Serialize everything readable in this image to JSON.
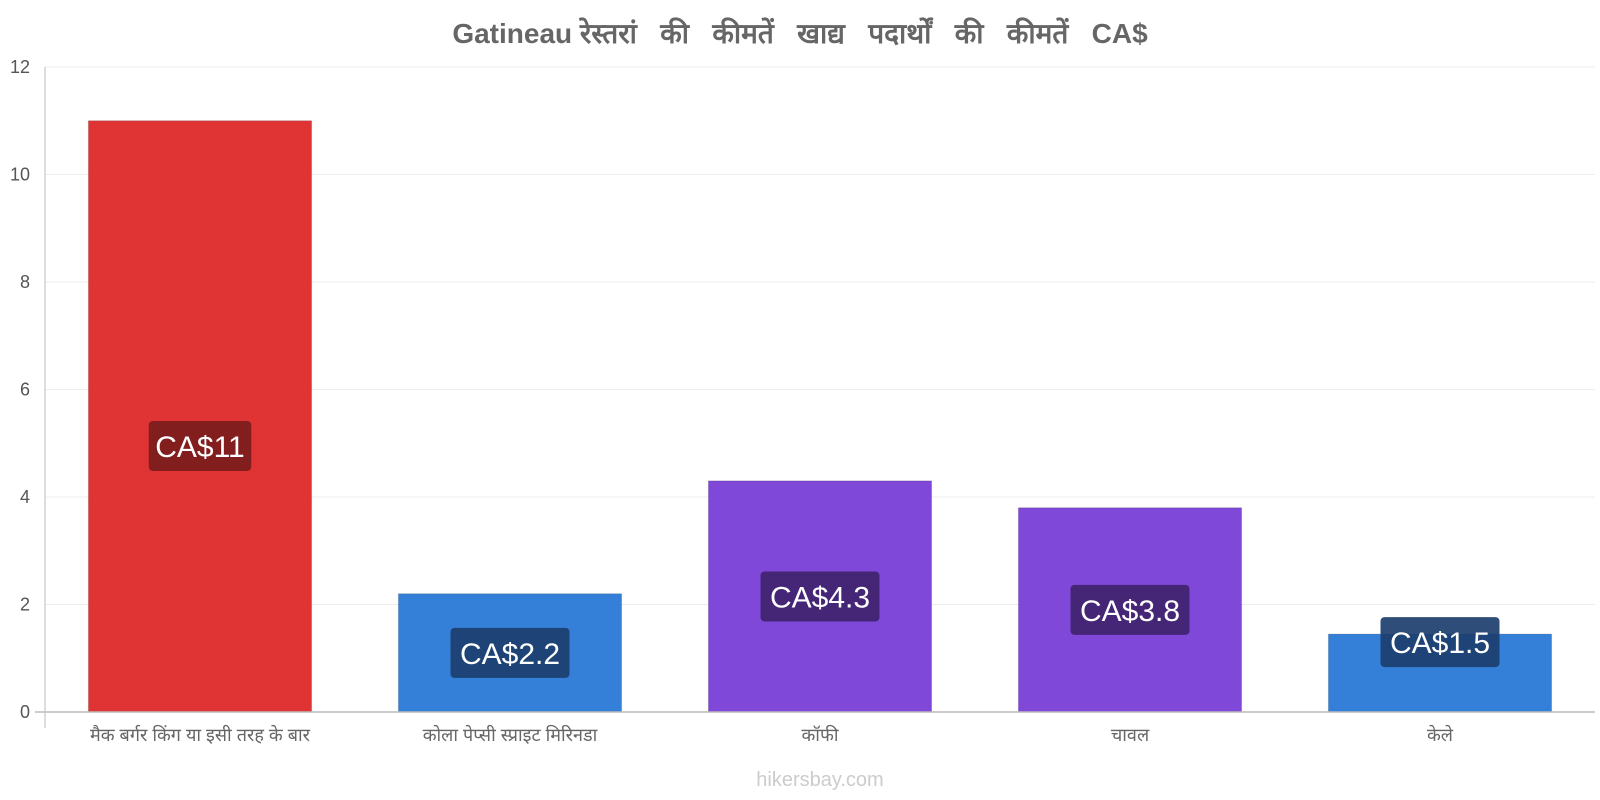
{
  "chart_data": {
    "type": "bar",
    "title": "Gatineau रेस्तरां   की   कीमतें   खाद्य   पदार्थों   की   कीमतें   CA$",
    "xlabel": "",
    "ylabel": "",
    "ylim": [
      0,
      12
    ],
    "yticks": [
      0,
      2,
      4,
      6,
      8,
      10,
      12
    ],
    "grid": true,
    "legend": "none",
    "categories": [
      "मैक बर्गर किंग या इसी तरह के बार",
      "कोला पेप्सी स्प्राइट मिरिनडा",
      "कॉफी",
      "चावल",
      "केले"
    ],
    "values": [
      11,
      2.2,
      4.3,
      3.8,
      1.45
    ],
    "data_labels": [
      "CA$11",
      "CA$2.2",
      "CA$4.3",
      "CA$3.8",
      "CA$1.5"
    ],
    "bar_colors": [
      "#e03434",
      "#3480d8",
      "#8048d8",
      "#8048d8",
      "#3480d8"
    ],
    "label_bg_colors": [
      "#7a1c1c",
      "#1c3e6e",
      "#40246e",
      "#40246e",
      "#1c3e6e"
    ]
  },
  "watermark": "hikersbay.com"
}
